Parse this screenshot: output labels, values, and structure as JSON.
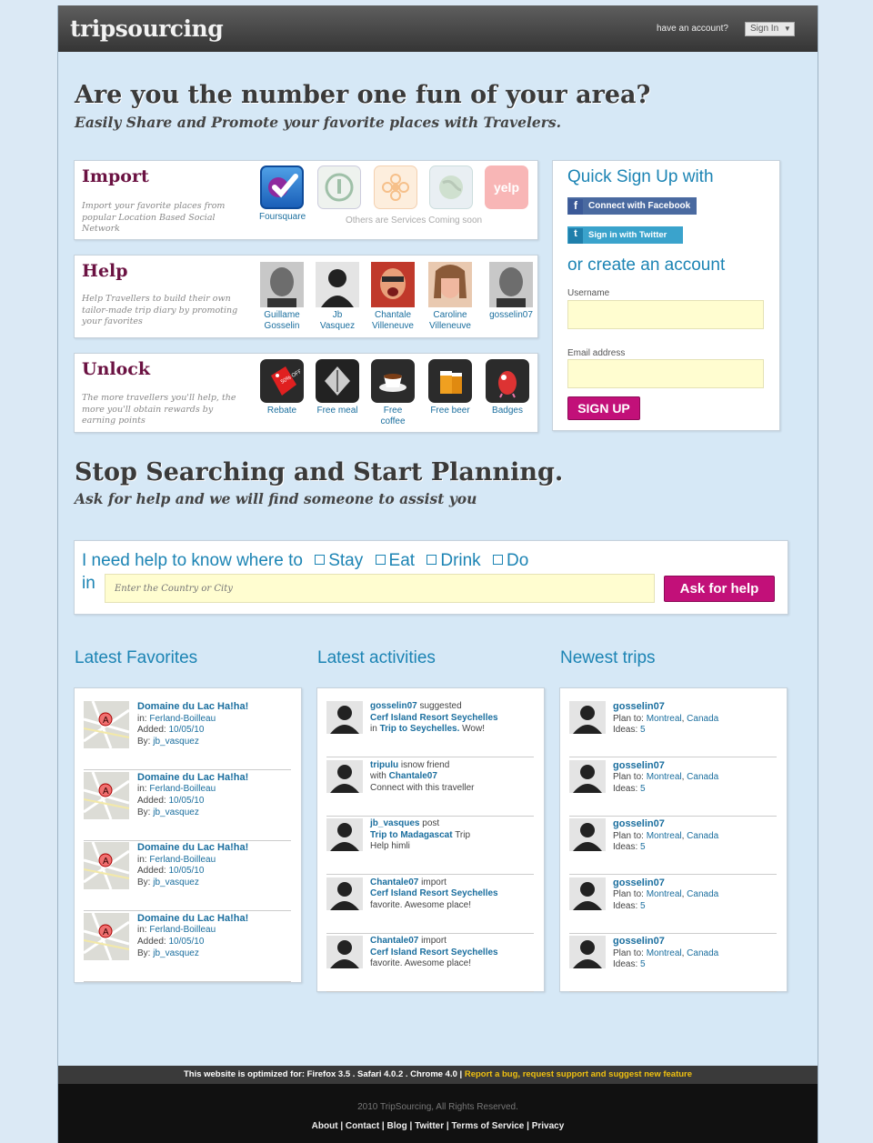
{
  "header": {
    "logo": "tripsourcing",
    "have_account": "have an account?",
    "sign_in": "Sign In"
  },
  "hero": {
    "title": "Are you the number one fun of your area?",
    "subtitle": "Easily Share and Promote your favorite places with Travelers."
  },
  "features": {
    "import": {
      "title": "Import",
      "desc": "Import your favorite places from popular Location Based Social Network",
      "tiles": [
        {
          "label": "Foursquare"
        }
      ],
      "coming_soon": "Others are Services Coming soon",
      "yelp": "yelp"
    },
    "help": {
      "title": "Help",
      "desc": "Help Travellers to build their own tailor-made trip diary by promoting your favorites",
      "people": [
        {
          "first": "Guillame",
          "last": "Gosselin"
        },
        {
          "first": "Jb",
          "last": "Vasquez"
        },
        {
          "first": "Chantale",
          "last": "Villeneuve"
        },
        {
          "first": "Caroline",
          "last": "Villeneuve"
        },
        {
          "first": "gosselin07",
          "last": ""
        }
      ]
    },
    "unlock": {
      "title": "Unlock",
      "desc": "The more travellers you'll help, the more you'll obtain rewards by earning points",
      "rewards": [
        {
          "label": "Rebate",
          "icon": "tag-icon",
          "tag_text": "50% OFF"
        },
        {
          "label": "Free meal",
          "icon": "meal-icon"
        },
        {
          "label": "Free coffee",
          "icon": "coffee-icon"
        },
        {
          "label": "Free beer",
          "icon": "beer-icon"
        },
        {
          "label": "Badges",
          "icon": "badge-icon"
        }
      ]
    }
  },
  "signup": {
    "quick_title": "Quick Sign Up with",
    "facebook": "Connect with Facebook",
    "twitter": "Sign in with Twitter",
    "create_title": "or create an account",
    "username_label": "Username",
    "email_label": "Email address",
    "button": "SIGN UP"
  },
  "planning": {
    "title": "Stop Searching and Start Planning.",
    "subtitle": "Ask for help and we will find someone to assist you"
  },
  "help_box": {
    "prefix": "I need help to know where to",
    "options": [
      "Stay",
      "Eat",
      "Drink",
      "Do"
    ],
    "in_label": "in",
    "placeholder": "Enter the Country or City",
    "button": "Ask for help"
  },
  "columns": {
    "favorites_title": "Latest Favorites",
    "activities_title": "Latest activities",
    "trips_title": "Newest trips"
  },
  "favorites": [
    {
      "title": "Domaine du Lac Ha!ha!",
      "in": "Ferland-Boilleau",
      "added": "10/05/10",
      "by": "jb_vasquez"
    },
    {
      "title": "Domaine du Lac Ha!ha!",
      "in": "Ferland-Boilleau",
      "added": "10/05/10",
      "by": "jb_vasquez"
    },
    {
      "title": "Domaine du Lac Ha!ha!",
      "in": "Ferland-Boilleau",
      "added": "10/05/10",
      "by": "jb_vasquez"
    },
    {
      "title": "Domaine du Lac Ha!ha!",
      "in": "Ferland-Boilleau",
      "added": "10/05/10",
      "by": "jb_vasquez"
    }
  ],
  "fav_labels": {
    "in": "in:",
    "added": "Added:",
    "by": "By:"
  },
  "activities": [
    {
      "user": "gosselin07",
      "verb": "suggested",
      "line2_pre": "",
      "line2_link": "Cerf Island Resort Seychelles",
      "line2_post": "",
      "line3_pre": "in",
      "line3_link": "Trip to Seychelles.",
      "line3_post": "Wow!"
    },
    {
      "user": "tripulu",
      "verb": "isnow friend",
      "line2_pre": "with",
      "line2_link": "Chantale07",
      "line2_post": "",
      "line3_pre": "Connect with this traveller",
      "line3_link": "",
      "line3_post": ""
    },
    {
      "user": "jb_vasques",
      "verb": "post",
      "line2_pre": "",
      "line2_link": "Trip to Madagascat",
      "line2_post": "Trip",
      "line3_pre": "Help himli",
      "line3_link": "",
      "line3_post": ""
    },
    {
      "user": "Chantale07",
      "verb": "import",
      "line2_pre": "",
      "line2_link": "Cerf Island Resort Seychelles",
      "line2_post": "",
      "line3_pre": "favorite. Awesome place!",
      "line3_link": "",
      "line3_post": ""
    },
    {
      "user": "Chantale07",
      "verb": "import",
      "line2_pre": "",
      "line2_link": "Cerf Island Resort Seychelles",
      "line2_post": "",
      "line3_pre": "favorite. Awesome place!",
      "line3_link": "",
      "line3_post": ""
    }
  ],
  "trips": [
    {
      "user": "gosselin07",
      "city": "Montreal",
      "country": "Canada",
      "ideas": "5"
    },
    {
      "user": "gosselin07",
      "city": "Montreal",
      "country": "Canada",
      "ideas": "5"
    },
    {
      "user": "gosselin07",
      "city": "Montreal",
      "country": "Canada",
      "ideas": "5"
    },
    {
      "user": "gosselin07",
      "city": "Montreal",
      "country": "Canada",
      "ideas": "5"
    },
    {
      "user": "gosselin07",
      "city": "Montreal",
      "country": "Canada",
      "ideas": "5"
    }
  ],
  "trip_labels": {
    "plan": "Plan to:",
    "ideas": "Ideas:"
  },
  "footer": {
    "optimized": "This website is optimized for: Firefox 3.5 . Safari 4.0.2 . Chrome 4.0 |",
    "report": "Report a bug, request support and suggest new feature",
    "copyright": "2010 TripSourcing, All Rights Reserved.",
    "links": [
      "About",
      "Contact",
      "Blog",
      "Twitter",
      "Terms of Service",
      "Privacy"
    ]
  },
  "colors": {
    "accent_pink": "#c21079",
    "link_blue": "#1a6e9e",
    "heading_blue": "#1c84b4",
    "field_yellow": "#fffdd0"
  }
}
